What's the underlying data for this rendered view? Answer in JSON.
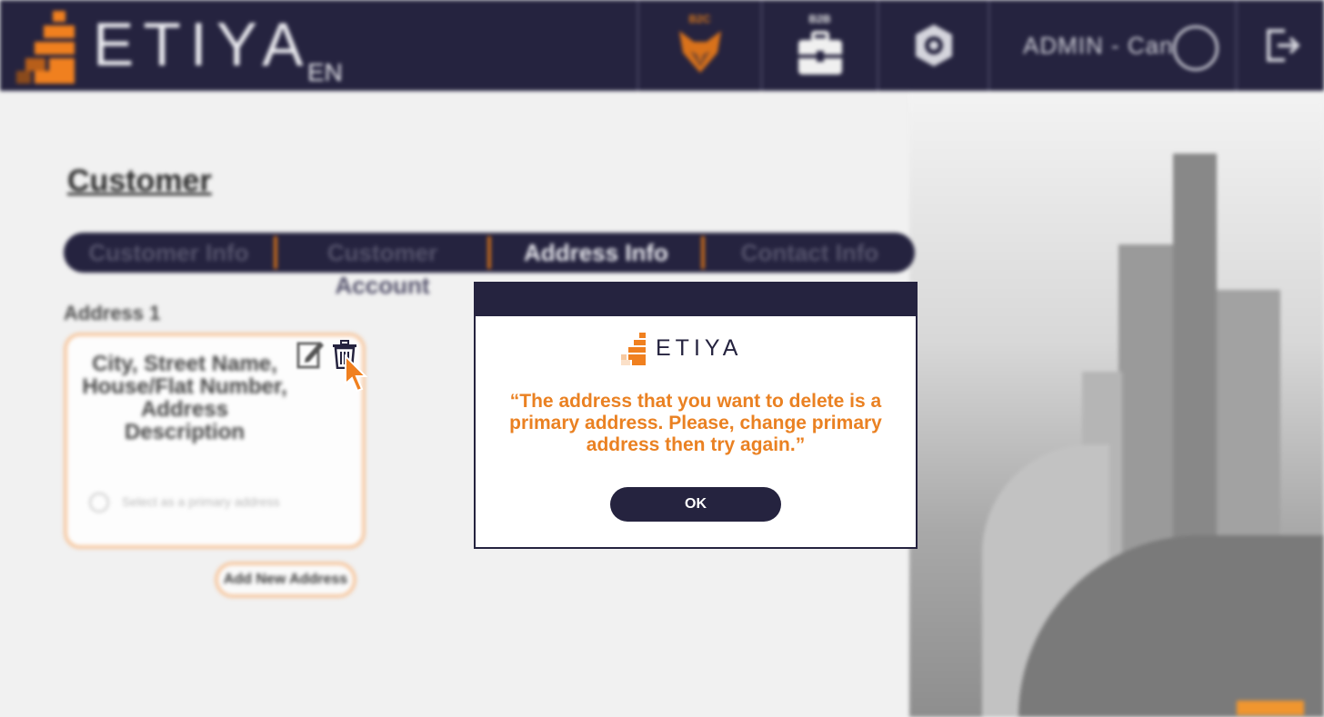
{
  "header": {
    "brand": "ETIYA",
    "language": "EN",
    "b2c_label": "B2C",
    "b2b_label": "B2B",
    "user_label": "ADMIN - Can"
  },
  "page": {
    "title": "Customer",
    "tabs": [
      {
        "label": "Customer Info",
        "active": false
      },
      {
        "label": "Customer Account",
        "active": false
      },
      {
        "label": "Address Info",
        "active": true
      },
      {
        "label": "Contact Info",
        "active": false
      }
    ],
    "address_title": "Address 1",
    "address_text": "City, Street Name, House/Flat Number, Address Description",
    "primary_radio_label": "Select as a primary address",
    "add_button": "Add New Address"
  },
  "modal": {
    "logo_text": "ETIYA",
    "message": "“The address that you want to delete is a primary address. Please, change primary address then try again.”",
    "ok_label": "OK"
  },
  "colors": {
    "navy": "#25233f",
    "orange": "#ea8122",
    "card_border": "#f6c9a3"
  },
  "icons": [
    "etiya-logo-icon",
    "b2c-fox-icon",
    "b2b-briefcase-icon",
    "settings-gear-icon",
    "user-avatar-icon",
    "logout-icon",
    "edit-icon",
    "trash-icon",
    "pointer-cursor-icon"
  ]
}
